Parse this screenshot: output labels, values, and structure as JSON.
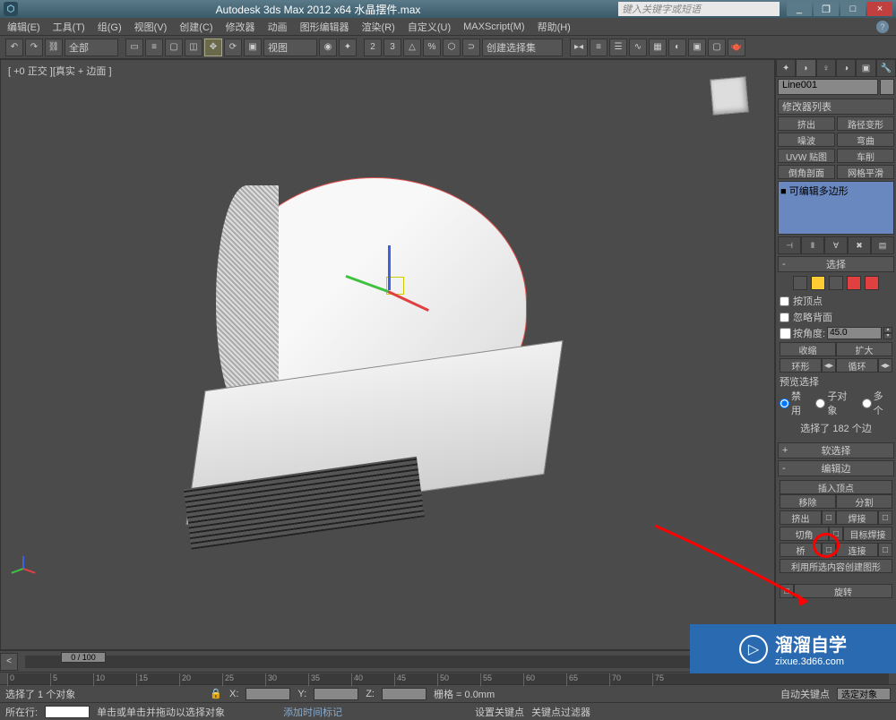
{
  "titlebar": {
    "title": "Autodesk 3ds Max 2012 x64    水晶摆件.max",
    "search_placeholder": "键入关键字或短语"
  },
  "menu": [
    "编辑(E)",
    "工具(T)",
    "组(G)",
    "视图(V)",
    "创建(C)",
    "修改器",
    "动画",
    "图形编辑器",
    "渲染(R)",
    "自定义(U)",
    "MAXScript(M)",
    "帮助(H)"
  ],
  "toolbar": {
    "sel_filter": "全部",
    "view_label": "视图",
    "selset": "创建选择集"
  },
  "viewport": {
    "label": "[ +0 正交 ][真实 + 边面 ]"
  },
  "panel": {
    "object_name": "Line001",
    "modifier_list": "修改器列表",
    "mod_buttons": [
      [
        "挤出",
        "路径变形"
      ],
      [
        "噪波",
        "弯曲"
      ],
      [
        "UVW 贴图",
        "车削"
      ],
      [
        "倒角剖面",
        "网格平滑"
      ]
    ],
    "stack_item": "■ 可编辑多边形",
    "rollouts": {
      "selection": {
        "title": "选择",
        "by_vertex": "按顶点",
        "ignore_backfacing": "忽略背面",
        "by_angle": "按角度:",
        "angle_value": "45.0",
        "shrink": "收缩",
        "grow": "扩大",
        "ring": "环形",
        "loop": "循环",
        "preview_label": "预览选择",
        "preview_opts": [
          "禁用",
          "子对象",
          "多个"
        ],
        "sel_info": "选择了 182 个边"
      },
      "soft_sel": "软选择",
      "edit_edges": {
        "title": "编辑边",
        "insert_vertex": "插入顶点",
        "remove": "移除",
        "split": "分割",
        "extrude": "挤出",
        "weld": "焊接",
        "chamfer": "切角",
        "target_weld": "目标焊接",
        "bridge": "桥",
        "connect": "连接",
        "create_shape": "利用所选内容创建图形",
        "rotate": "旋转"
      }
    }
  },
  "timeline": {
    "handle": "0 / 100",
    "ticks": [
      "0",
      "5",
      "10",
      "15",
      "20",
      "25",
      "30",
      "35",
      "40",
      "45",
      "50",
      "55",
      "60",
      "65",
      "70",
      "75"
    ]
  },
  "status": {
    "sel_msg": "选择了 1 个对象",
    "hint": "单击或单击并拖动以选择对象",
    "x_label": "X:",
    "y_label": "Y:",
    "z_label": "Z:",
    "grid": "栅格 = 0.0mm",
    "autokey": "自动关键点",
    "selected": "选定对象",
    "add_time": "添加时间标记",
    "set_key": "设置关键点",
    "key_filter": "关键点过滤器",
    "goto_label": "所在行:"
  },
  "watermark": {
    "brand": "溜溜自学",
    "url": "zixue.3d66.com"
  }
}
